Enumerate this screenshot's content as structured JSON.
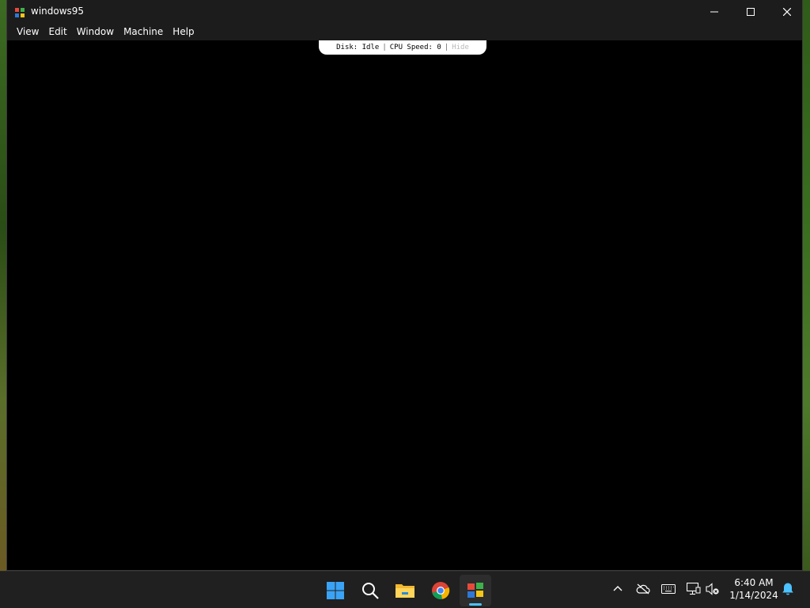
{
  "window": {
    "title": "windows95",
    "menu": [
      "View",
      "Edit",
      "Window",
      "Machine",
      "Help"
    ]
  },
  "status_bar": {
    "disk": "Disk: Idle",
    "separator": "|",
    "cpu": "CPU Speed: 0",
    "hide": "Hide"
  },
  "taskbar": {
    "icons": [
      "start-icon",
      "search-icon",
      "file-explorer-icon",
      "chrome-icon",
      "windows95-app-icon"
    ],
    "tray_icons": [
      "chevron-up-icon",
      "onedrive-offline-icon",
      "keyboard-icon",
      "network-icon",
      "speaker-muted-icon",
      "notification-bell-icon"
    ],
    "time": "6:40 AM",
    "date": "1/14/2024"
  },
  "colors": {
    "titlebar": "#1c1c1c",
    "taskbar": "#202020",
    "accent": "#4cc2ff"
  }
}
